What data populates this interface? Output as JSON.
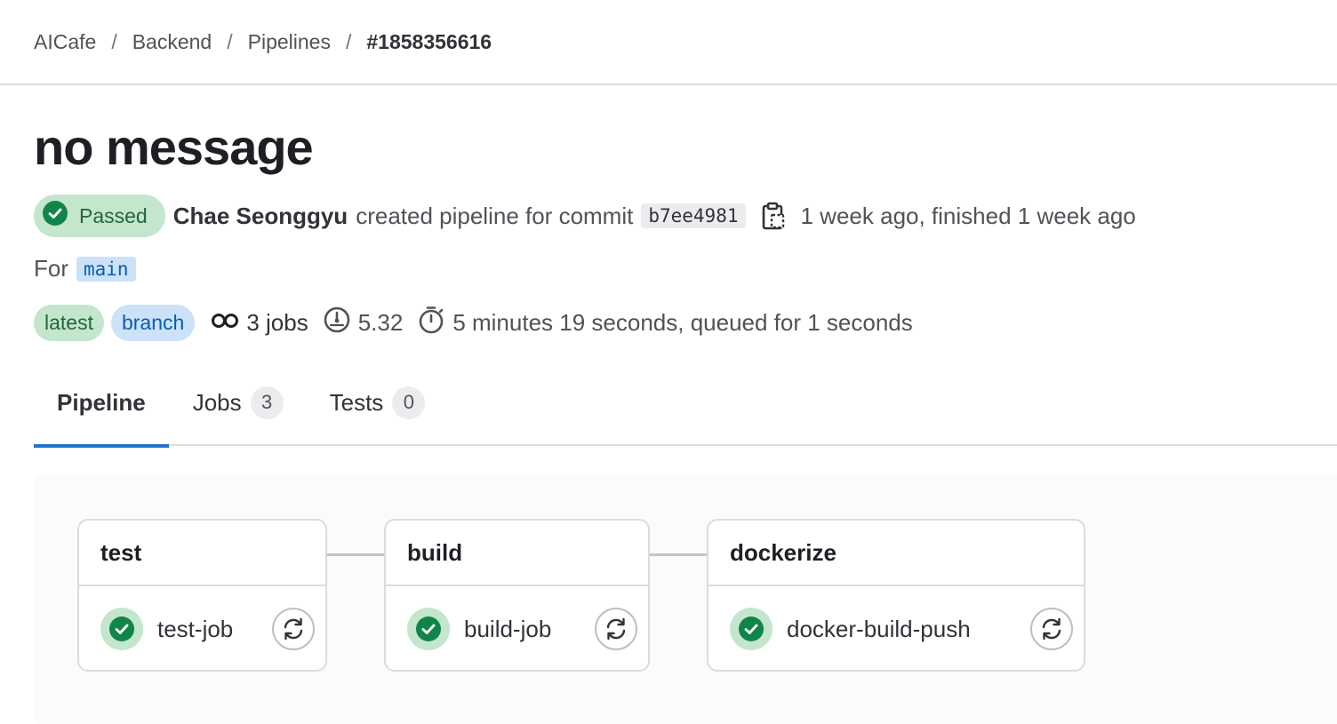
{
  "breadcrumb": {
    "items": [
      "AICafe",
      "Backend",
      "Pipelines"
    ],
    "current": "#1858356616",
    "separator": "/"
  },
  "title": "no message",
  "status": {
    "label": "Passed",
    "color": "#108548",
    "icon": "status-success-icon"
  },
  "commit": {
    "author": "Chae Seonggyu",
    "action_text": "created pipeline for commit",
    "sha": "b7ee4981",
    "copy_icon": "copy-to-clipboard-icon",
    "time_text": "1 week ago, finished 1 week ago"
  },
  "ref": {
    "prefix": "For",
    "name": "main"
  },
  "badges": [
    {
      "label": "latest",
      "variant": "success"
    },
    {
      "label": "branch",
      "variant": "info"
    }
  ],
  "stats": {
    "jobs": "3 jobs",
    "jobs_icon": "pipeline-icon",
    "compute": "5.32",
    "compute_icon": "dashboard-icon",
    "duration": "5 minutes 19 seconds, queued for 1 seconds",
    "duration_icon": "timer-icon"
  },
  "tabs": [
    {
      "label": "Pipeline",
      "active": true
    },
    {
      "label": "Jobs",
      "count": "3"
    },
    {
      "label": "Tests",
      "count": "0"
    }
  ],
  "stages": [
    {
      "name": "test",
      "job": "test-job",
      "status": "success"
    },
    {
      "name": "build",
      "job": "build-job",
      "status": "success"
    },
    {
      "name": "dockerize",
      "job": "docker-build-push",
      "status": "success"
    }
  ],
  "colors": {
    "accent": "#1f75cb",
    "success_bg": "#c3e6cd",
    "success": "#108548"
  }
}
